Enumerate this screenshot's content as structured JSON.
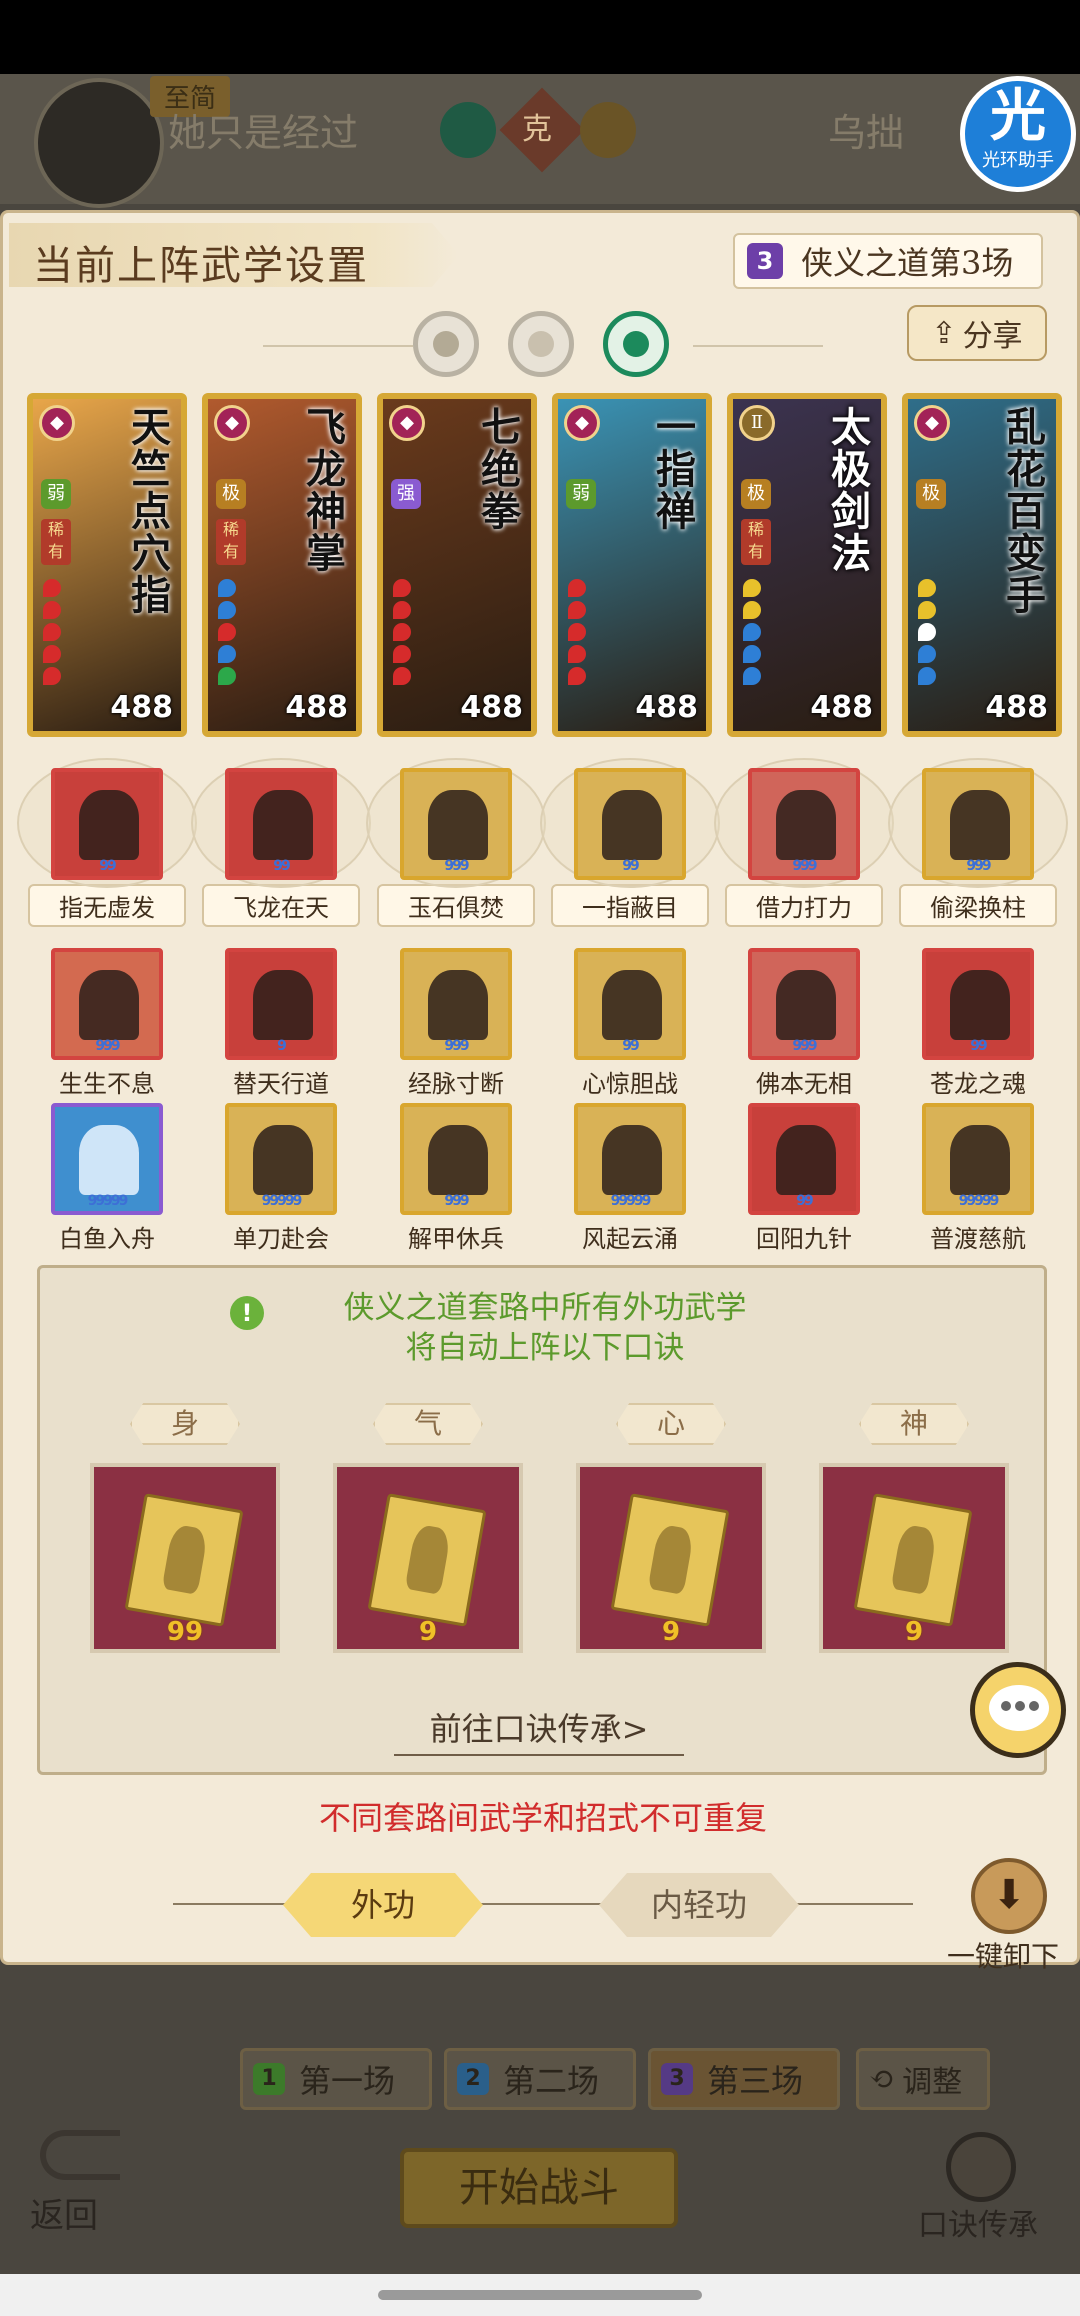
{
  "header": {
    "title": "当前上阵武学设置",
    "match_num": "3",
    "match_tag": "侠义之道第3场",
    "share": "分享"
  },
  "versus": {
    "tag": "至简",
    "left_name": "她只是经过",
    "center": "克",
    "right_name": "乌拙"
  },
  "brand": {
    "big": "光",
    "small": "光环助手"
  },
  "cards": [
    {
      "name": "天竺点穴指",
      "tier": "弱",
      "rare": "稀有",
      "level": "488",
      "rank": "◆",
      "bg": "#e8a64a"
    },
    {
      "name": "飞龙神掌",
      "tier": "极",
      "rare": "稀有",
      "level": "488",
      "rank": "◆",
      "bg": "#b15a2e"
    },
    {
      "name": "七绝拳",
      "tier": "强",
      "rare": "",
      "level": "488",
      "rank": "◆",
      "bg": "#6a3a1c"
    },
    {
      "name": "一指禅",
      "tier": "弱",
      "rare": "",
      "level": "488",
      "rank": "◆",
      "bg": "#3a93b5"
    },
    {
      "name": "太极剑法",
      "tier": "极",
      "rare": "稀有",
      "level": "488",
      "rank": "Ⅱ",
      "bg": "#3b3350"
    },
    {
      "name": "乱花百变手",
      "tier": "极",
      "rare": "",
      "level": "488",
      "rank": "◆",
      "bg": "#2f6e8a"
    }
  ],
  "skills_row1": [
    {
      "label": "指无虚发",
      "stars": "99"
    },
    {
      "label": "飞龙在天",
      "stars": "99"
    },
    {
      "label": "玉石俱焚",
      "stars": "999"
    },
    {
      "label": "一指蔽目",
      "stars": "99"
    },
    {
      "label": "借力打力",
      "stars": "999"
    },
    {
      "label": "偷梁换柱",
      "stars": "999"
    }
  ],
  "skills_row2": [
    {
      "label": "生生不息",
      "stars": "999"
    },
    {
      "label": "替天行道",
      "stars": "9"
    },
    {
      "label": "经脉寸断",
      "stars": "999"
    },
    {
      "label": "心惊胆战",
      "stars": "99"
    },
    {
      "label": "佛本无相",
      "stars": "999"
    },
    {
      "label": "苍龙之魂",
      "stars": "99"
    }
  ],
  "skills_row3": [
    {
      "label": "白鱼入舟",
      "stars": "99999"
    },
    {
      "label": "单刀赴会",
      "stars": "99999"
    },
    {
      "label": "解甲休兵",
      "stars": "999"
    },
    {
      "label": "风起云涌",
      "stars": "99999"
    },
    {
      "label": "回阳九针",
      "stars": "99"
    },
    {
      "label": "普渡慈航",
      "stars": "99999"
    }
  ],
  "koujue": {
    "notice_line1": "侠义之道套路中所有外功武学",
    "notice_line2": "将自动上阵以下口诀",
    "slots": [
      {
        "label": "身",
        "num": "99"
      },
      {
        "label": "气",
        "num": "9"
      },
      {
        "label": "心",
        "num": "9"
      },
      {
        "label": "神",
        "num": "9"
      }
    ],
    "goto": "前往口诀传承>"
  },
  "warning": "不同套路间武学和招式不可重复",
  "tabs": {
    "outer": "外功",
    "inner": "内轻功"
  },
  "unload": "一键卸下",
  "rounds": [
    {
      "num": "1",
      "label": "第一场",
      "color": "#3c7a2a"
    },
    {
      "num": "2",
      "label": "第二场",
      "color": "#2a5f8a"
    },
    {
      "num": "3",
      "label": "第三场",
      "color": "#553a85"
    }
  ],
  "adjust": "调整",
  "start": "开始战斗",
  "back": "返回",
  "koujue_transfer": "口诀传承",
  "colors": {
    "accent_green": "#1c8a5c",
    "warn_red": "#d12c2c",
    "gold": "#d6a835"
  }
}
